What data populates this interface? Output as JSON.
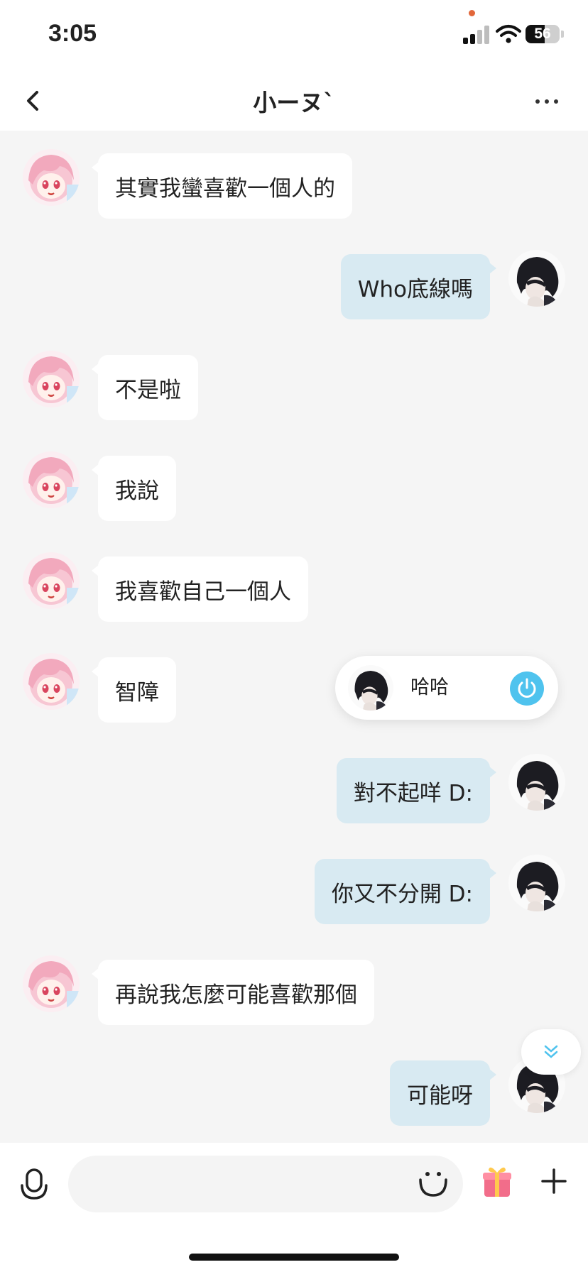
{
  "status_bar": {
    "time": "3:05",
    "battery": "56",
    "battery_level_percent": 56
  },
  "header": {
    "title": "小ーヌ`"
  },
  "colors": {
    "outgoing_bubble": "#d8eaf2",
    "incoming_bubble": "#ffffff",
    "accent": "#4fc3ee"
  },
  "messages": [
    {
      "side": "left",
      "text": "其實我蠻喜歡一個人的"
    },
    {
      "side": "right",
      "text": "Who底線嗎"
    },
    {
      "side": "left",
      "text": "不是啦"
    },
    {
      "side": "left",
      "text": "我說"
    },
    {
      "side": "left",
      "text": "我喜歡自己一個人"
    },
    {
      "side": "left",
      "text": "智障"
    },
    {
      "side": "right",
      "text": "對不起咩 D:"
    },
    {
      "side": "right",
      "text": "你又不分開 D:"
    },
    {
      "side": "left",
      "text": "再說我怎麼可能喜歡那個"
    },
    {
      "side": "right",
      "text": "可能呀"
    }
  ],
  "call_popup": {
    "text": "哈哈"
  },
  "icons": {
    "back": "chevron-left-icon",
    "more": "more-horizontal-icon",
    "mic": "microphone-icon",
    "emoji": "smiley-icon",
    "gift": "gift-icon",
    "plus": "plus-icon",
    "power": "power-icon",
    "scroll_down": "double-chevron-down-icon"
  },
  "input": {
    "placeholder": ""
  }
}
